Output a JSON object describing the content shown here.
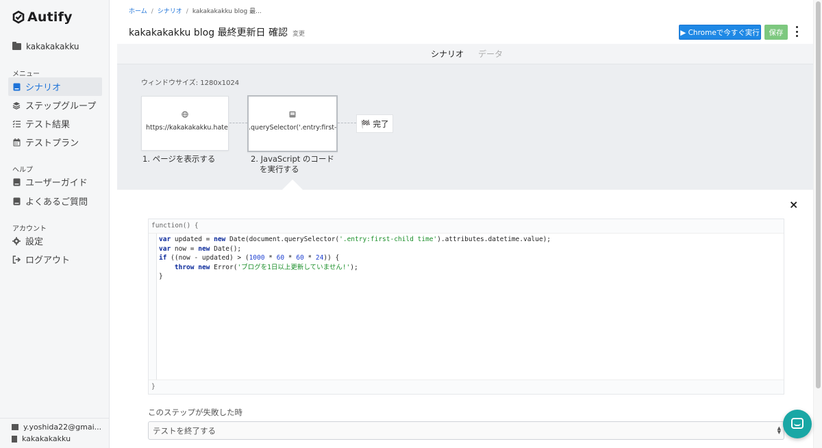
{
  "brand": {
    "name": "Autify",
    "color": "#1d1d1f",
    "accent": "#1e73d8"
  },
  "sidebar": {
    "project": "kakakakakku",
    "menu_label": "メニュー",
    "menu_items": [
      {
        "label": "シナリオ",
        "icon": "scenario-icon",
        "active": true
      },
      {
        "label": "ステップグループ",
        "icon": "layers-icon",
        "active": false
      },
      {
        "label": "テスト結果",
        "icon": "checklist-icon",
        "active": false
      },
      {
        "label": "テストプラン",
        "icon": "calendar-icon",
        "active": false
      }
    ],
    "help_label": "ヘルプ",
    "help_items": [
      {
        "label": "ユーザーガイド",
        "icon": "book-icon"
      },
      {
        "label": "よくあるご質問",
        "icon": "book-icon"
      }
    ],
    "account_label": "アカウント",
    "account_items": [
      {
        "label": "設定",
        "icon": "gear-icon"
      },
      {
        "label": "ログアウト",
        "icon": "logout-icon"
      }
    ],
    "footer": {
      "email": "y.yoshida22@gmai...",
      "org": "kakakakakku"
    }
  },
  "breadcrumb": {
    "home": "ホーム",
    "scenario": "シナリオ",
    "current": "kakakakakku blog 最..."
  },
  "header": {
    "title": "kakakakakku blog 最終更新日 確認",
    "change_label": "変更",
    "run_label": "▶ Chromeで今すぐ実行",
    "save_label": "保存",
    "run_color": "#1e88e5",
    "save_color": "#7dc87f"
  },
  "tabs": [
    {
      "label": "シナリオ",
      "active": true
    },
    {
      "label": "データ",
      "active": false
    }
  ],
  "flow": {
    "window_size": "ウィンドウサイズ: 1280x1024",
    "steps": [
      {
        "icon": "globe-icon",
        "text": "https://kakakakakku.hatenablog.com/",
        "label": "1. ページを表示する"
      },
      {
        "icon": "code-icon",
        "text": ".querySelector('.entry:first-chi",
        "label_line1": "2. JavaScript のコード",
        "label_line2": "を実行する"
      }
    ],
    "done_label": "🏁 完了"
  },
  "editor": {
    "header": "function() {",
    "footer": "}",
    "lines": [
      "var updated = new Date(document.querySelector('.entry:first-child time').attributes.datetime.value);",
      "var now = new Date();",
      "if ((now - updated) > (1000 * 60 * 60 * 24)) {",
      "    throw new Error('ブログを1日以上更新していません!');",
      "}"
    ]
  },
  "failure": {
    "label": "このステップが失敗した時",
    "selected": "テストを終了する"
  }
}
